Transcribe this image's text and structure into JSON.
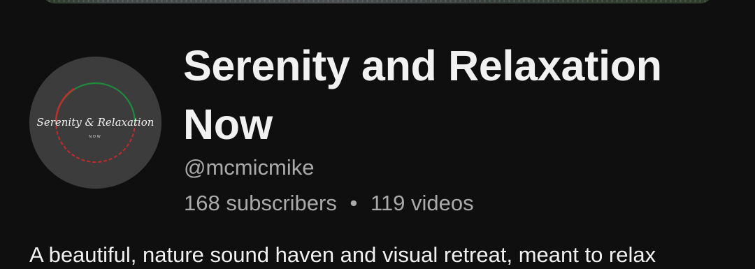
{
  "channel": {
    "title": "Serenity and Relaxation Now",
    "handle": "@mcmicmike",
    "subscribers": "168 subscribers",
    "separator": "•",
    "videos": "119 videos",
    "description_preview": "A beautiful, nature sound haven and visual retreat, meant to relax",
    "logo_text": "Serenity & Relaxation",
    "logo_subtext": "NOW"
  },
  "colors": {
    "background": "#0f0f0f",
    "title": "#f1f1f1",
    "meta_text": "#aaaaaa",
    "avatar_bg": "#3c3c3c",
    "ring_green": "#1f8a3c",
    "ring_red": "#c42b2b"
  }
}
